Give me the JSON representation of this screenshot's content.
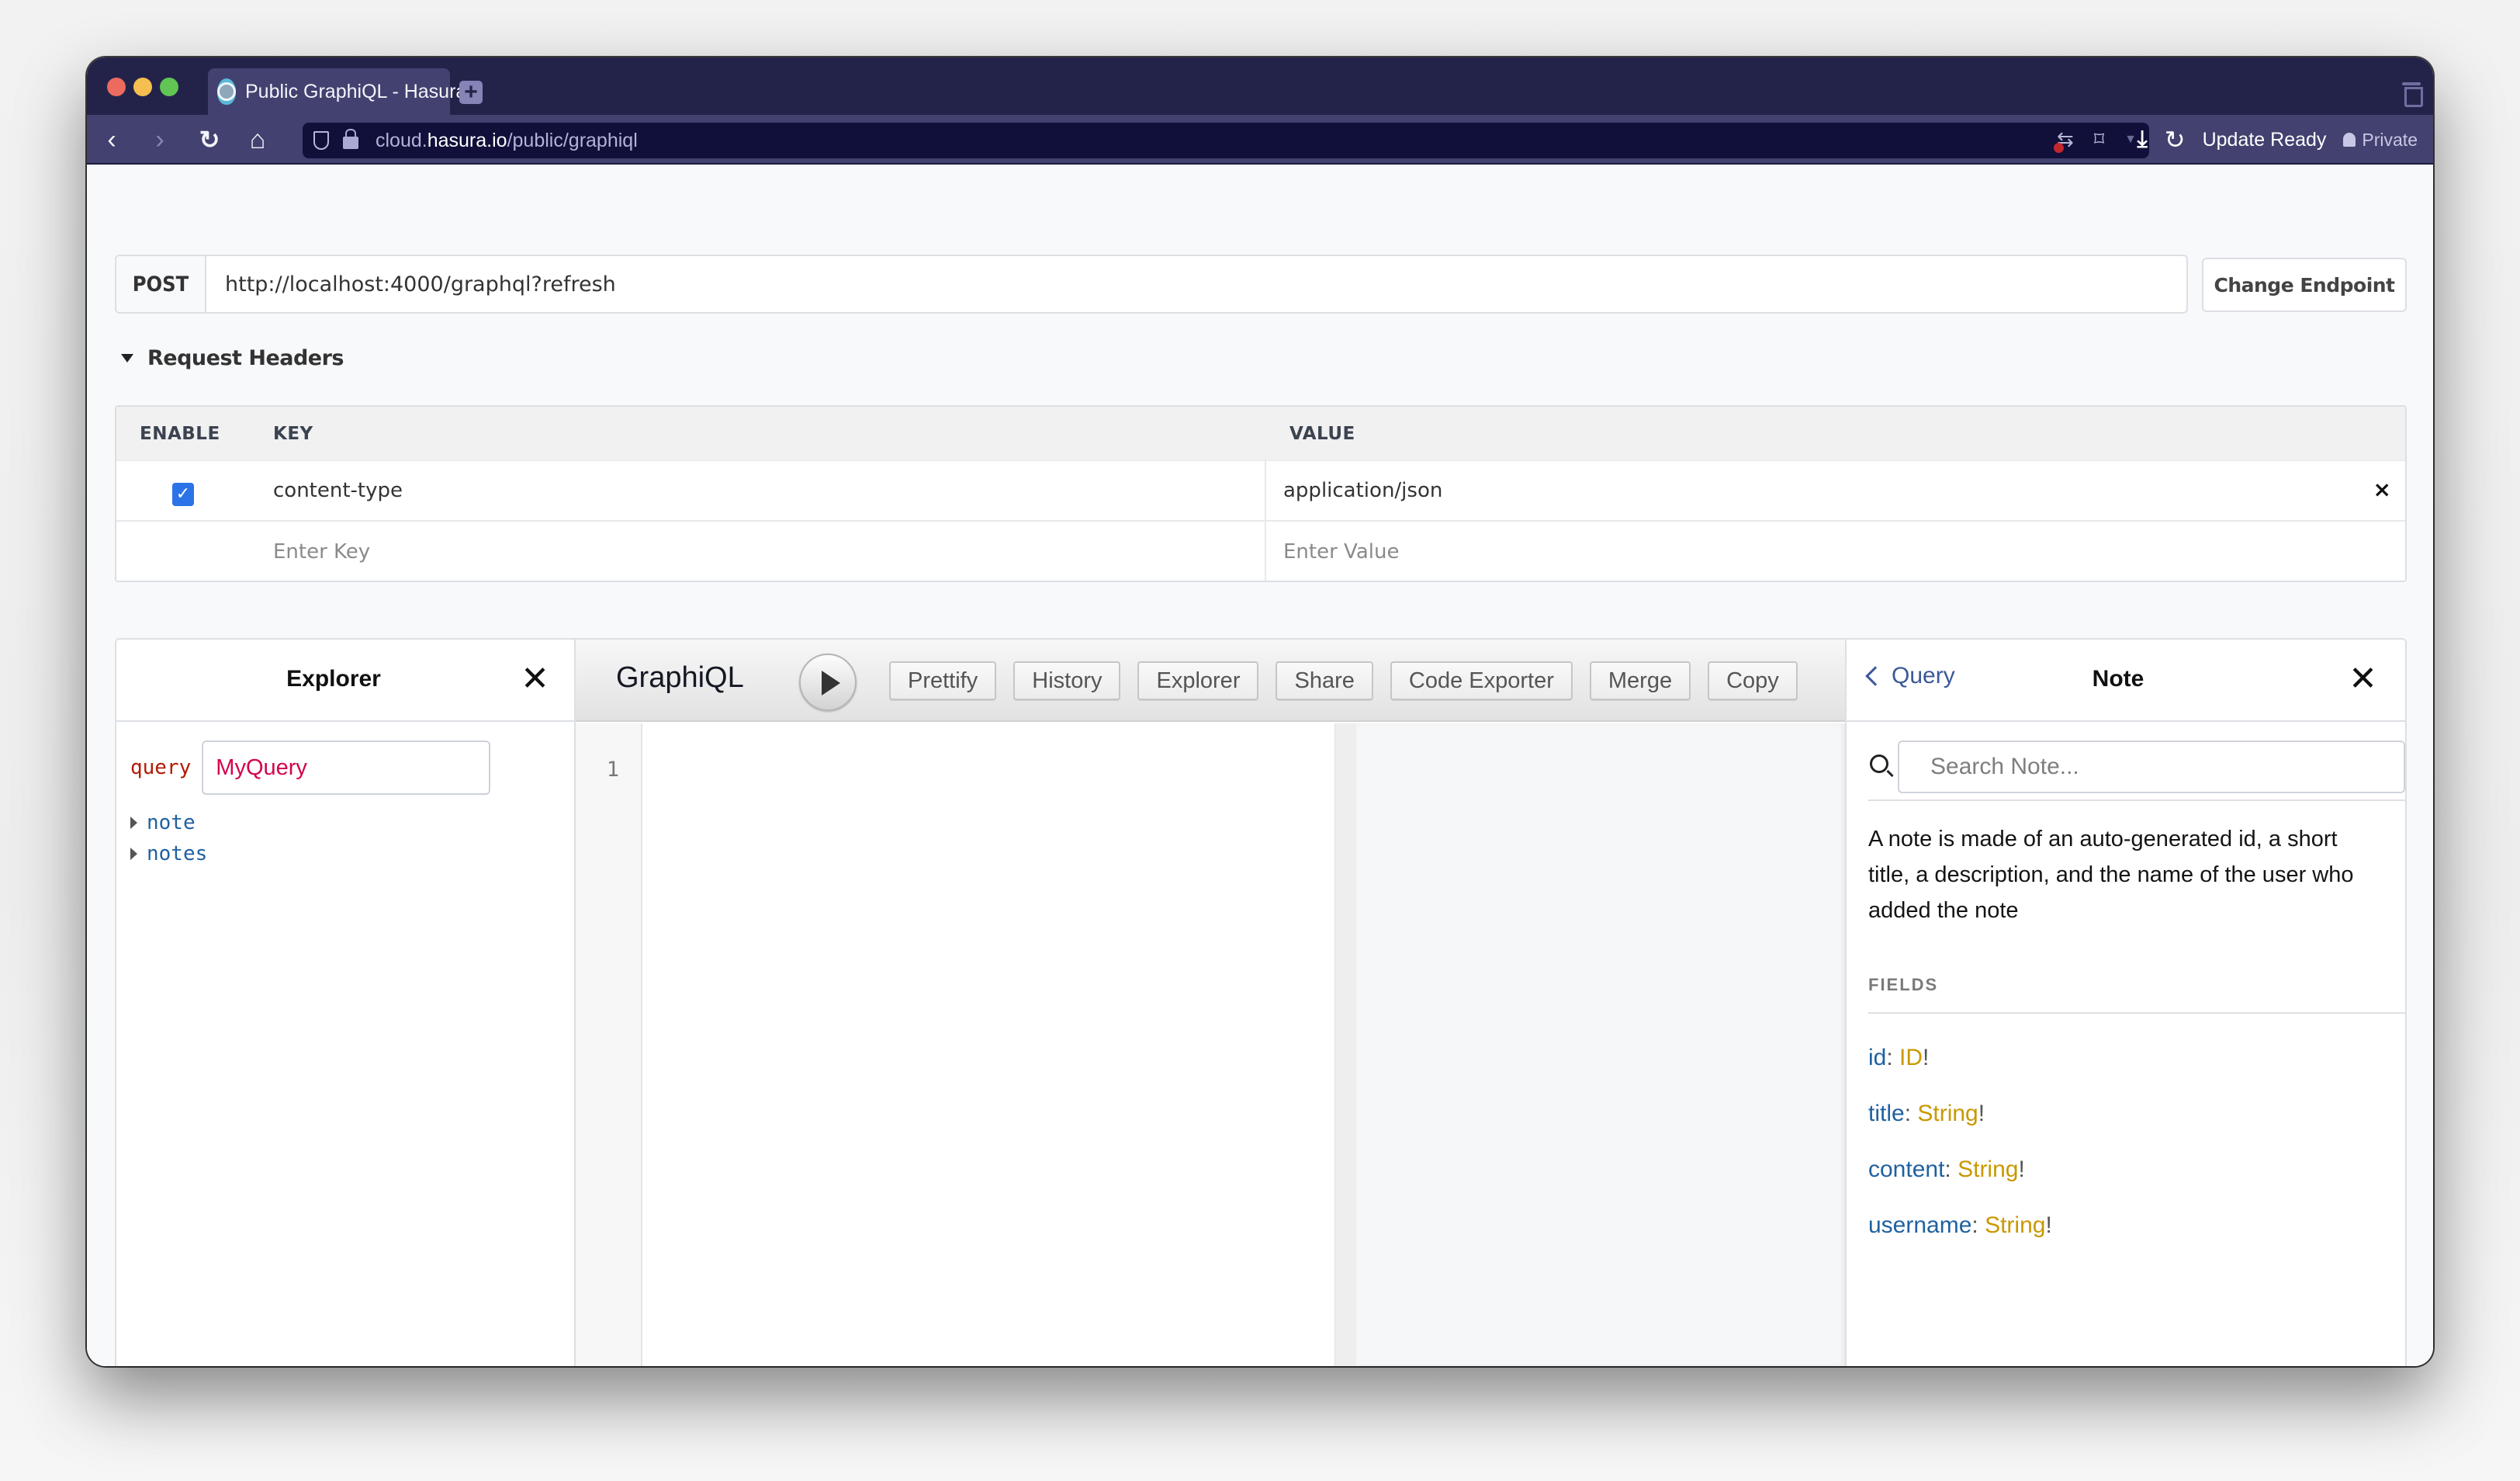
{
  "browser": {
    "tab_title": "Public GraphiQL - Hasura",
    "url_domain_prefix": "cloud.",
    "url_domain": "hasura.io",
    "url_path": "/public/graphiql",
    "update_label": "Update Ready",
    "private_label": "Private",
    "icons": {
      "back": "‹",
      "forward": "›",
      "reload": "↻",
      "home": "⌂",
      "download": "⤓",
      "new_tab": "+",
      "bookmark": "⌑",
      "translate": "⇆",
      "dropdown": "▼"
    }
  },
  "endpoint": {
    "method": "POST",
    "url": "http://localhost:4000/graphql?refresh",
    "change_label": "Change Endpoint"
  },
  "request_headers": {
    "title": "Request Headers",
    "columns": [
      "ENABLE",
      "KEY",
      "VALUE"
    ],
    "rows": [
      {
        "enabled": true,
        "key": "content-type",
        "value": "application/json"
      }
    ],
    "new_row": {
      "key_placeholder": "Enter Key",
      "value_placeholder": "Enter Value"
    },
    "remove_icon": "×",
    "check_icon": "✓"
  },
  "explorer": {
    "title": "Explorer",
    "close_icon": "✕",
    "operation_keyword": "query",
    "operation_name": "MyQuery",
    "fields": [
      "note",
      "notes"
    ]
  },
  "graphiql": {
    "logo": "GraphiQL",
    "toolbar_buttons": [
      "Prettify",
      "History",
      "Explorer",
      "Share",
      "Code Exporter",
      "Merge",
      "Copy"
    ],
    "line_numbers": [
      "1"
    ],
    "query_text": ""
  },
  "docs": {
    "back_label": "Query",
    "title": "Note",
    "close_icon": "✕",
    "search_placeholder": "Search Note...",
    "description": "A note is made of an auto-generated id, a short title, a description, and the name of the user who added the note",
    "fields_label": "FIELDS",
    "fields": [
      {
        "name": "id",
        "type": "ID",
        "required": "!"
      },
      {
        "name": "title",
        "type": "String",
        "required": "!"
      },
      {
        "name": "content",
        "type": "String",
        "required": "!"
      },
      {
        "name": "username",
        "type": "String",
        "required": "!"
      }
    ]
  },
  "colors": {
    "browser_chrome": "#23234a",
    "browser_tab": "#42416f",
    "checkbox_accent": "#2b73e6",
    "field_name": "#1f61a0",
    "type_name": "#ca9800",
    "operation_name": "#d2054e",
    "keyword": "#b11a04"
  }
}
